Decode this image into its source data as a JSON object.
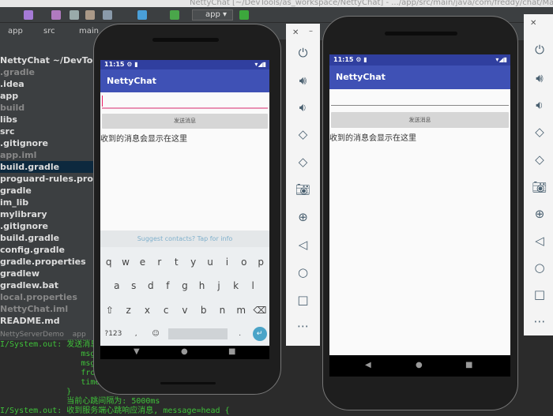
{
  "ide": {
    "window_title": "NettyChat [~/DevTools/as_workspace/NettyChat] - .../app/src/main/java/com/freddy/chat/MainActivity",
    "run_config": "app",
    "breadcrumbs": [
      "app",
      "src",
      "main"
    ],
    "project_header": "NettyChat  ~/DevTools/as_w",
    "tree": [
      {
        "label": ".gradle",
        "dim": true
      },
      {
        "label": ".idea"
      },
      {
        "label": "app"
      },
      {
        "label": "build",
        "dim": true
      },
      {
        "label": "libs"
      },
      {
        "label": "src"
      },
      {
        "label": ".gitignore"
      },
      {
        "label": "app.iml",
        "dim": true
      },
      {
        "label": "build.gradle",
        "selected": true
      },
      {
        "label": "proguard-rules.pro"
      },
      {
        "label": "gradle"
      },
      {
        "label": "im_lib"
      },
      {
        "label": "mylibrary"
      },
      {
        "label": ".gitignore"
      },
      {
        "label": "build.gradle"
      },
      {
        "label": "config.gradle"
      },
      {
        "label": "gradle.properties"
      },
      {
        "label": "gradlew"
      },
      {
        "label": "gradlew.bat"
      },
      {
        "label": "local.properties",
        "dim": true
      },
      {
        "label": "NettyChat.iml",
        "dim": true
      },
      {
        "label": "README.md"
      }
    ],
    "bottom_tabs": [
      "NettyServerDemo",
      "app"
    ],
    "log_lines": [
      "I/System.out: 发送消息...",
      "                 msgId",
      "                 msgTy",
      "                 fromI",
      "                 times",
      "              }",
      "              当前心跳间隔为: 5000ms",
      "I/System.out: 收到服务端心跳响应消息, message=head {"
    ]
  },
  "phone1": {
    "time": "11:15",
    "app_title": "NettyChat",
    "send_button": "发送消息",
    "message_text": "收到的消息会显示在这里",
    "input_value": "",
    "suggestion": "Suggest contacts? Tap for info",
    "keyboard": {
      "row1": [
        "q",
        "w",
        "e",
        "r",
        "t",
        "y",
        "u",
        "i",
        "o",
        "p"
      ],
      "row2": [
        "a",
        "s",
        "d",
        "f",
        "g",
        "h",
        "j",
        "k",
        "l"
      ],
      "row3": [
        "z",
        "x",
        "c",
        "v",
        "b",
        "n",
        "m"
      ],
      "symbols": "?123",
      "comma": ",",
      "period": "."
    }
  },
  "phone2": {
    "time": "11:15",
    "app_title": "NettyChat",
    "send_button": "发送消息",
    "message_text": "收到的消息会显示在这里",
    "input_value": ""
  },
  "colors": {
    "primary": "#3f51b5",
    "primary_dark": "#303f9f",
    "accent": "#e91e63",
    "log_green": "#3fc13a"
  }
}
